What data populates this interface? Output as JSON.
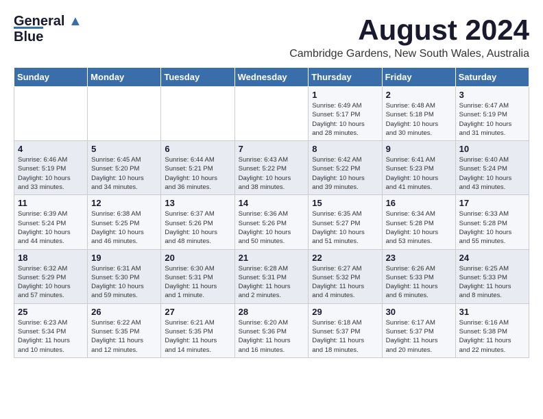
{
  "header": {
    "logo": {
      "line1": "General",
      "line2": "Blue"
    },
    "title": "August 2024",
    "subtitle": "Cambridge Gardens, New South Wales, Australia"
  },
  "calendar": {
    "headers": [
      "Sunday",
      "Monday",
      "Tuesday",
      "Wednesday",
      "Thursday",
      "Friday",
      "Saturday"
    ],
    "weeks": [
      [
        {
          "day": "",
          "info": ""
        },
        {
          "day": "",
          "info": ""
        },
        {
          "day": "",
          "info": ""
        },
        {
          "day": "",
          "info": ""
        },
        {
          "day": "1",
          "info": "Sunrise: 6:49 AM\nSunset: 5:17 PM\nDaylight: 10 hours\nand 28 minutes."
        },
        {
          "day": "2",
          "info": "Sunrise: 6:48 AM\nSunset: 5:18 PM\nDaylight: 10 hours\nand 30 minutes."
        },
        {
          "day": "3",
          "info": "Sunrise: 6:47 AM\nSunset: 5:19 PM\nDaylight: 10 hours\nand 31 minutes."
        }
      ],
      [
        {
          "day": "4",
          "info": "Sunrise: 6:46 AM\nSunset: 5:19 PM\nDaylight: 10 hours\nand 33 minutes."
        },
        {
          "day": "5",
          "info": "Sunrise: 6:45 AM\nSunset: 5:20 PM\nDaylight: 10 hours\nand 34 minutes."
        },
        {
          "day": "6",
          "info": "Sunrise: 6:44 AM\nSunset: 5:21 PM\nDaylight: 10 hours\nand 36 minutes."
        },
        {
          "day": "7",
          "info": "Sunrise: 6:43 AM\nSunset: 5:22 PM\nDaylight: 10 hours\nand 38 minutes."
        },
        {
          "day": "8",
          "info": "Sunrise: 6:42 AM\nSunset: 5:22 PM\nDaylight: 10 hours\nand 39 minutes."
        },
        {
          "day": "9",
          "info": "Sunrise: 6:41 AM\nSunset: 5:23 PM\nDaylight: 10 hours\nand 41 minutes."
        },
        {
          "day": "10",
          "info": "Sunrise: 6:40 AM\nSunset: 5:24 PM\nDaylight: 10 hours\nand 43 minutes."
        }
      ],
      [
        {
          "day": "11",
          "info": "Sunrise: 6:39 AM\nSunset: 5:24 PM\nDaylight: 10 hours\nand 44 minutes."
        },
        {
          "day": "12",
          "info": "Sunrise: 6:38 AM\nSunset: 5:25 PM\nDaylight: 10 hours\nand 46 minutes."
        },
        {
          "day": "13",
          "info": "Sunrise: 6:37 AM\nSunset: 5:26 PM\nDaylight: 10 hours\nand 48 minutes."
        },
        {
          "day": "14",
          "info": "Sunrise: 6:36 AM\nSunset: 5:26 PM\nDaylight: 10 hours\nand 50 minutes."
        },
        {
          "day": "15",
          "info": "Sunrise: 6:35 AM\nSunset: 5:27 PM\nDaylight: 10 hours\nand 51 minutes."
        },
        {
          "day": "16",
          "info": "Sunrise: 6:34 AM\nSunset: 5:28 PM\nDaylight: 10 hours\nand 53 minutes."
        },
        {
          "day": "17",
          "info": "Sunrise: 6:33 AM\nSunset: 5:28 PM\nDaylight: 10 hours\nand 55 minutes."
        }
      ],
      [
        {
          "day": "18",
          "info": "Sunrise: 6:32 AM\nSunset: 5:29 PM\nDaylight: 10 hours\nand 57 minutes."
        },
        {
          "day": "19",
          "info": "Sunrise: 6:31 AM\nSunset: 5:30 PM\nDaylight: 10 hours\nand 59 minutes."
        },
        {
          "day": "20",
          "info": "Sunrise: 6:30 AM\nSunset: 5:31 PM\nDaylight: 11 hours\nand 1 minute."
        },
        {
          "day": "21",
          "info": "Sunrise: 6:28 AM\nSunset: 5:31 PM\nDaylight: 11 hours\nand 2 minutes."
        },
        {
          "day": "22",
          "info": "Sunrise: 6:27 AM\nSunset: 5:32 PM\nDaylight: 11 hours\nand 4 minutes."
        },
        {
          "day": "23",
          "info": "Sunrise: 6:26 AM\nSunset: 5:33 PM\nDaylight: 11 hours\nand 6 minutes."
        },
        {
          "day": "24",
          "info": "Sunrise: 6:25 AM\nSunset: 5:33 PM\nDaylight: 11 hours\nand 8 minutes."
        }
      ],
      [
        {
          "day": "25",
          "info": "Sunrise: 6:23 AM\nSunset: 5:34 PM\nDaylight: 11 hours\nand 10 minutes."
        },
        {
          "day": "26",
          "info": "Sunrise: 6:22 AM\nSunset: 5:35 PM\nDaylight: 11 hours\nand 12 minutes."
        },
        {
          "day": "27",
          "info": "Sunrise: 6:21 AM\nSunset: 5:35 PM\nDaylight: 11 hours\nand 14 minutes."
        },
        {
          "day": "28",
          "info": "Sunrise: 6:20 AM\nSunset: 5:36 PM\nDaylight: 11 hours\nand 16 minutes."
        },
        {
          "day": "29",
          "info": "Sunrise: 6:18 AM\nSunset: 5:37 PM\nDaylight: 11 hours\nand 18 minutes."
        },
        {
          "day": "30",
          "info": "Sunrise: 6:17 AM\nSunset: 5:37 PM\nDaylight: 11 hours\nand 20 minutes."
        },
        {
          "day": "31",
          "info": "Sunrise: 6:16 AM\nSunset: 5:38 PM\nDaylight: 11 hours\nand 22 minutes."
        }
      ]
    ]
  }
}
